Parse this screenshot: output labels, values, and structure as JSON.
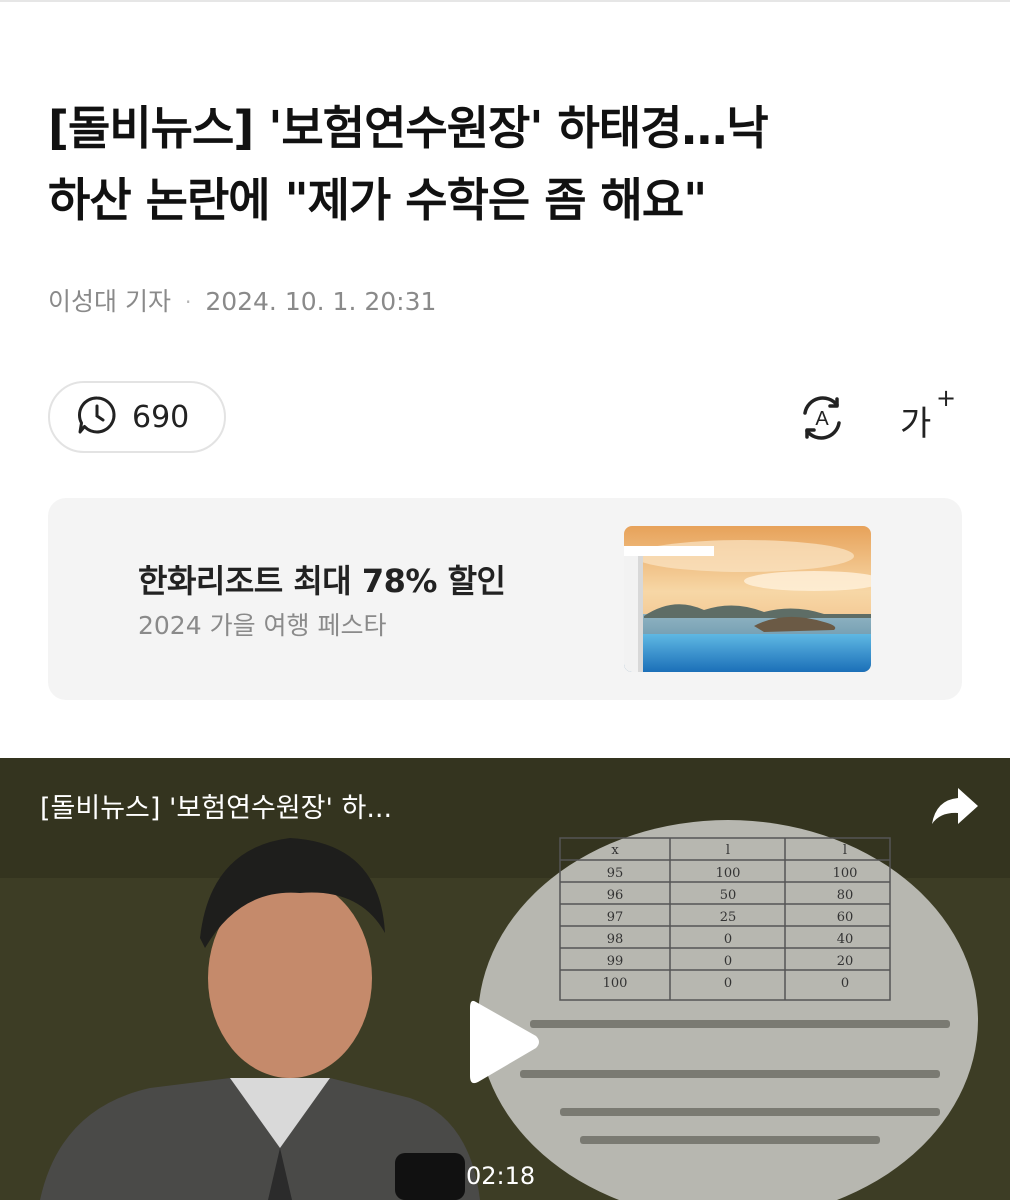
{
  "article": {
    "title_line1": "[돌비뉴스] '보험연수원장' 하태경…낙",
    "title_line2": "하산 논란에 \"제가 수학은 좀 해요\"",
    "author": "이성대 기자",
    "separator": "·",
    "datetime": "2024. 10. 1. 20:31"
  },
  "toolbar": {
    "view_count": "690",
    "translate_icon": "translate-icon",
    "font_size_label": "가",
    "font_size_plus": "+"
  },
  "ad": {
    "title": "한화리조트 최대 78% 할인",
    "subtitle": "2024 가을 여행 페스타"
  },
  "video": {
    "title": "[돌비뉴스] '보험연수원장' 하...",
    "duration": "02:18",
    "table_header": [
      "x",
      "l",
      "l"
    ],
    "table_rows": [
      [
        "95",
        "100",
        "100"
      ],
      [
        "96",
        "50",
        "80"
      ],
      [
        "97",
        "25",
        "60"
      ],
      [
        "98",
        "0",
        "40"
      ],
      [
        "99",
        "0",
        "20"
      ],
      [
        "100",
        "0",
        "0"
      ]
    ]
  },
  "colors": {
    "accent_text": "#111111",
    "meta_gray": "#8a8a8a",
    "card_bg": "#f4f4f4",
    "video_bg": "#3d3d25"
  }
}
